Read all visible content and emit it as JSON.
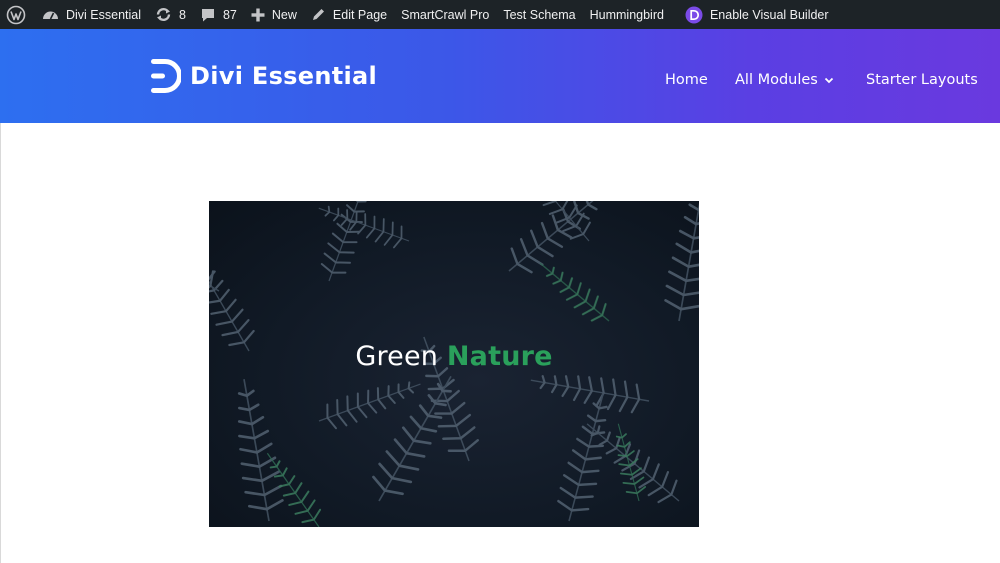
{
  "admin_bar": {
    "site_name": "Divi Essential",
    "updates_count": "8",
    "comments_count": "87",
    "new_label": "New",
    "edit_page_label": "Edit Page",
    "smartcrawl_label": "SmartCrawl Pro",
    "test_schema_label": "Test Schema",
    "hummingbird_label": "Hummingbird",
    "visual_builder_label": "Enable Visual Builder",
    "icons": [
      "wordpress-icon",
      "dashboard-icon",
      "refresh-icon",
      "comment-icon",
      "plus-icon",
      "pencil-icon",
      "divi-icon"
    ]
  },
  "header": {
    "logo_text": "Divi Essential",
    "nav": {
      "home": "Home",
      "all_modules": "All Modules",
      "starter_layouts": "Starter Layouts"
    }
  },
  "hero": {
    "title_plain": "Green",
    "title_accent": "Nature"
  },
  "colors": {
    "admin_bar_bg": "#1d2327",
    "header_gradient_start": "#2d6ff0",
    "header_gradient_end": "#6a39df",
    "accent_green": "#2aa05b",
    "hero_bg": "#111a26"
  }
}
